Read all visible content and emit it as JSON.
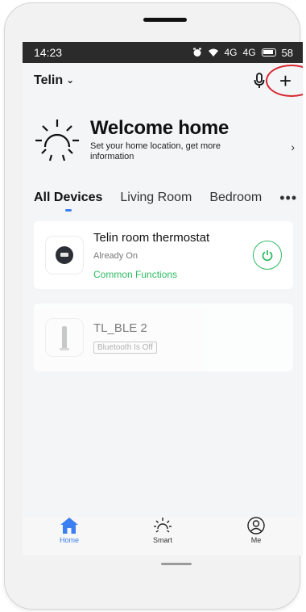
{
  "status_bar": {
    "time": "14:23",
    "signal_1": "4G",
    "signal_2": "4G",
    "battery": "58"
  },
  "header": {
    "home_name": "Telin",
    "chevron": "⌄",
    "mic_icon": "mic-icon",
    "add_icon": "+",
    "highlight_color": "#d8262f"
  },
  "welcome": {
    "title": "Welcome home",
    "subtitle": "Set your home location, get more information",
    "arrow": "›"
  },
  "tabs": [
    {
      "label": "All Devices",
      "active": true
    },
    {
      "label": "Living Room",
      "active": false
    },
    {
      "label": "Bedroom",
      "active": false
    }
  ],
  "more_icon": "•••",
  "devices": [
    {
      "name": "Telin room thermostat",
      "status": "Already On",
      "link": "Common Functions",
      "icon": "thermostat-icon",
      "power": "power-icon"
    },
    {
      "name": "TL_BLE 2",
      "badge": "Bluetooth Is Off",
      "icon": "ble-device-icon"
    }
  ],
  "bottom_nav": [
    {
      "label": "Home",
      "icon": "home-icon",
      "active": true
    },
    {
      "label": "Smart",
      "icon": "sun-icon",
      "active": false
    },
    {
      "label": "Me",
      "icon": "user-icon",
      "active": false
    }
  ],
  "colors": {
    "accent": "#3b7ff0",
    "online": "#2fbb62",
    "status_bar": "#2b2b2b"
  }
}
